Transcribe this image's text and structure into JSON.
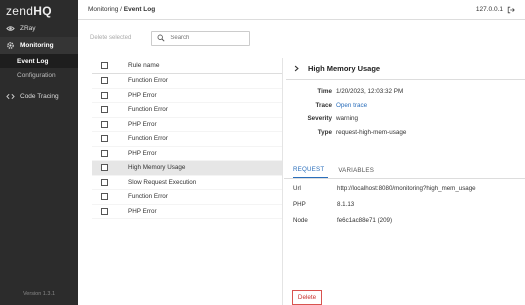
{
  "sidebar": {
    "logo_prefix": "zend",
    "logo_suffix": "HQ",
    "items": [
      {
        "label": "ZRay",
        "icon": "eye-icon"
      },
      {
        "label": "Monitoring",
        "icon": "gear-icon"
      },
      {
        "label": "Code Tracing",
        "icon": "code-icon"
      }
    ],
    "monitoring_children": [
      {
        "label": "Event Log",
        "active": true
      },
      {
        "label": "Configuration",
        "active": false
      }
    ],
    "version": "Version 1.3.1"
  },
  "topbar": {
    "breadcrumb_parent": "Monitoring",
    "breadcrumb_sep": " / ",
    "breadcrumb_current": "Event Log",
    "host": "127.0.0.1",
    "logout_icon": "logout-icon"
  },
  "toolbar": {
    "delete_selected_label": "Delete selected",
    "search_placeholder": "Search"
  },
  "list": {
    "header": "Rule name",
    "rows": [
      "Function Error",
      "PHP Error",
      "Function Error",
      "PHP Error",
      "Function Error",
      "PHP Error",
      "High Memory Usage",
      "Slow Request Execution",
      "Function Error",
      "PHP Error"
    ],
    "selected_index": 6
  },
  "detail": {
    "title": "High Memory Usage",
    "fields": {
      "time_label": "Time",
      "time_value": "1/20/2023, 12:03:32 PM",
      "trace_label": "Trace",
      "trace_value": "Open trace",
      "severity_label": "Severity",
      "severity_value": "warning",
      "type_label": "Type",
      "type_value": "request-high-mem-usage"
    },
    "tabs": [
      {
        "label": "REQUEST",
        "active": true
      },
      {
        "label": "VARIABLES",
        "active": false
      }
    ],
    "request": {
      "url_label": "Url",
      "url_value": "http://localhost:8080/monitoring?high_mem_usage",
      "php_label": "PHP",
      "php_value": "8.1.13",
      "node_label": "Node",
      "node_value": "fe6c1ac88e71 (209)"
    },
    "delete_label": "Delete"
  },
  "colors": {
    "sidebar_bg": "#2c2c2c",
    "accent": "#2a6ebb",
    "danger": "#d9534f"
  }
}
